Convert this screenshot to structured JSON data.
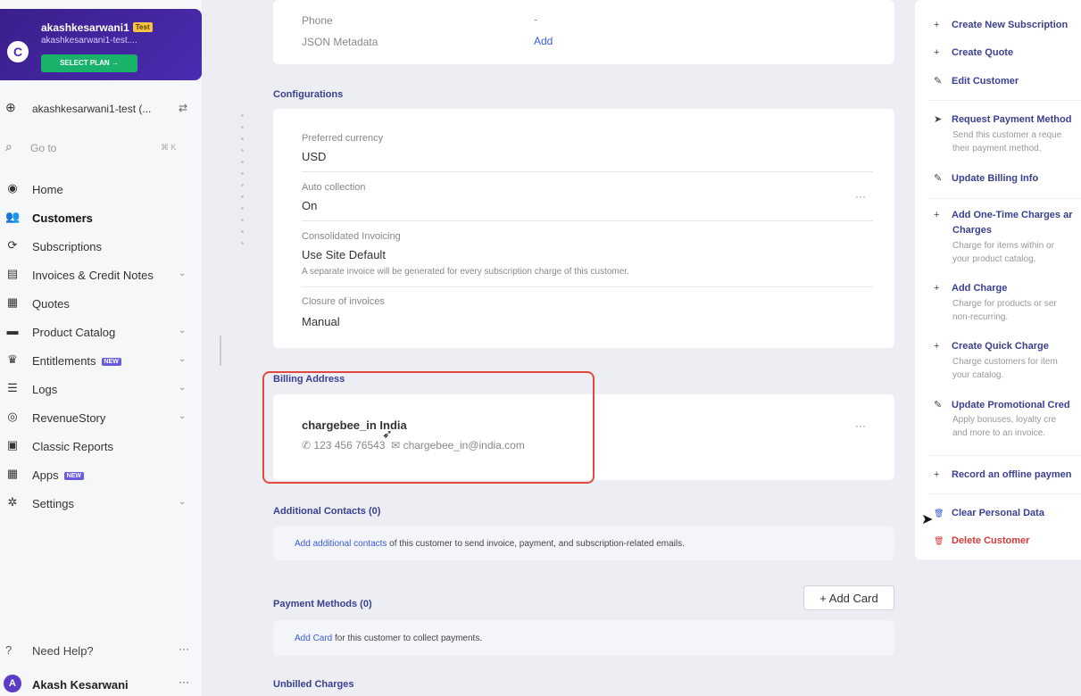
{
  "sidebar": {
    "site_name": "akashkesarwani1",
    "site_badge": "Test",
    "site_sub": "akashkesarwani1-test....",
    "select_plan": "SELECT PLAN",
    "account": "akashkesarwani1-test (...",
    "goto_placeholder": "Go to",
    "goto_shortcut": "⌘ K",
    "items": [
      {
        "label": "Home",
        "icon": "home-icon"
      },
      {
        "label": "Customers",
        "icon": "customers-icon"
      },
      {
        "label": "Subscriptions",
        "icon": "subscriptions-icon"
      },
      {
        "label": "Invoices & Credit Notes",
        "icon": "invoice-icon"
      },
      {
        "label": "Quotes",
        "icon": "quote-icon"
      },
      {
        "label": "Product Catalog",
        "icon": "catalog-icon"
      },
      {
        "label": "Entitlements",
        "icon": "crown-icon",
        "badge": "NEW"
      },
      {
        "label": "Logs",
        "icon": "logs-icon"
      },
      {
        "label": "RevenueStory",
        "icon": "revenue-icon"
      },
      {
        "label": "Classic Reports",
        "icon": "reports-icon"
      },
      {
        "label": "Apps",
        "icon": "apps-icon",
        "badge": "NEW"
      },
      {
        "label": "Settings",
        "icon": "gear-icon"
      }
    ],
    "help": "Need Help?",
    "user_initial": "A",
    "user_name": "Akash Kesarwani"
  },
  "details": {
    "phone_label": "Phone",
    "phone_value": "-",
    "json_label": "JSON Metadata",
    "json_action": "Add"
  },
  "configurations": {
    "title": "Configurations",
    "currency_label": "Preferred currency",
    "currency_value": "USD",
    "auto_label": "Auto collection",
    "auto_value": "On",
    "consolidated_label": "Consolidated Invoicing",
    "consolidated_value": "Use Site Default",
    "consolidated_note": "A separate invoice will be generated for every subscription charge of this customer.",
    "closure_label": "Closure of invoices",
    "closure_value": "Manual",
    "more": "···"
  },
  "billing": {
    "title": "Billing Address",
    "name": "chargebee_in India",
    "phone": "123 456 76543",
    "email": "chargebee_in@india.com",
    "more": "···"
  },
  "contacts": {
    "title": "Additional Contacts (0)",
    "link": "Add additional contacts",
    "text": " of this customer to send invoice, payment, and subscription-related emails."
  },
  "payment": {
    "title": "Payment Methods (0)",
    "add_card_button": "+ Add Card",
    "link": "Add Card",
    "text": " for this customer to collect payments."
  },
  "unbilled": {
    "title": "Unbilled Charges"
  },
  "actions": [
    {
      "icon": "+",
      "label": "Create New Subscription"
    },
    {
      "icon": "+",
      "label": "Create Quote"
    },
    {
      "icon": "✎",
      "label": "Edit Customer"
    },
    {
      "icon": "➤",
      "label": "Request Payment Method",
      "desc": [
        "Send this customer a reque",
        "their payment method."
      ]
    },
    {
      "icon": "✎",
      "label": "Update Billing Info"
    },
    {
      "icon": "+",
      "label": "Add One-Time Charges ar",
      "label2": "Charges",
      "desc": [
        "Charge for items within or",
        "your product catalog."
      ]
    },
    {
      "icon": "+",
      "label": "Add Charge",
      "desc": [
        "Charge for products or ser",
        "non-recurring."
      ]
    },
    {
      "icon": "+",
      "label": "Create Quick Charge",
      "desc": [
        "Charge customers for item",
        "your catalog."
      ]
    },
    {
      "icon": "✎",
      "label": "Update Promotional Cred",
      "desc": [
        "Apply bonuses, loyalty cre",
        "and more to an invoice."
      ]
    },
    {
      "icon": "+",
      "label": "Record an offline paymen"
    },
    {
      "icon": "🗑",
      "label": "Clear Personal Data"
    },
    {
      "icon": "🗑",
      "label": "Delete Customer"
    }
  ]
}
